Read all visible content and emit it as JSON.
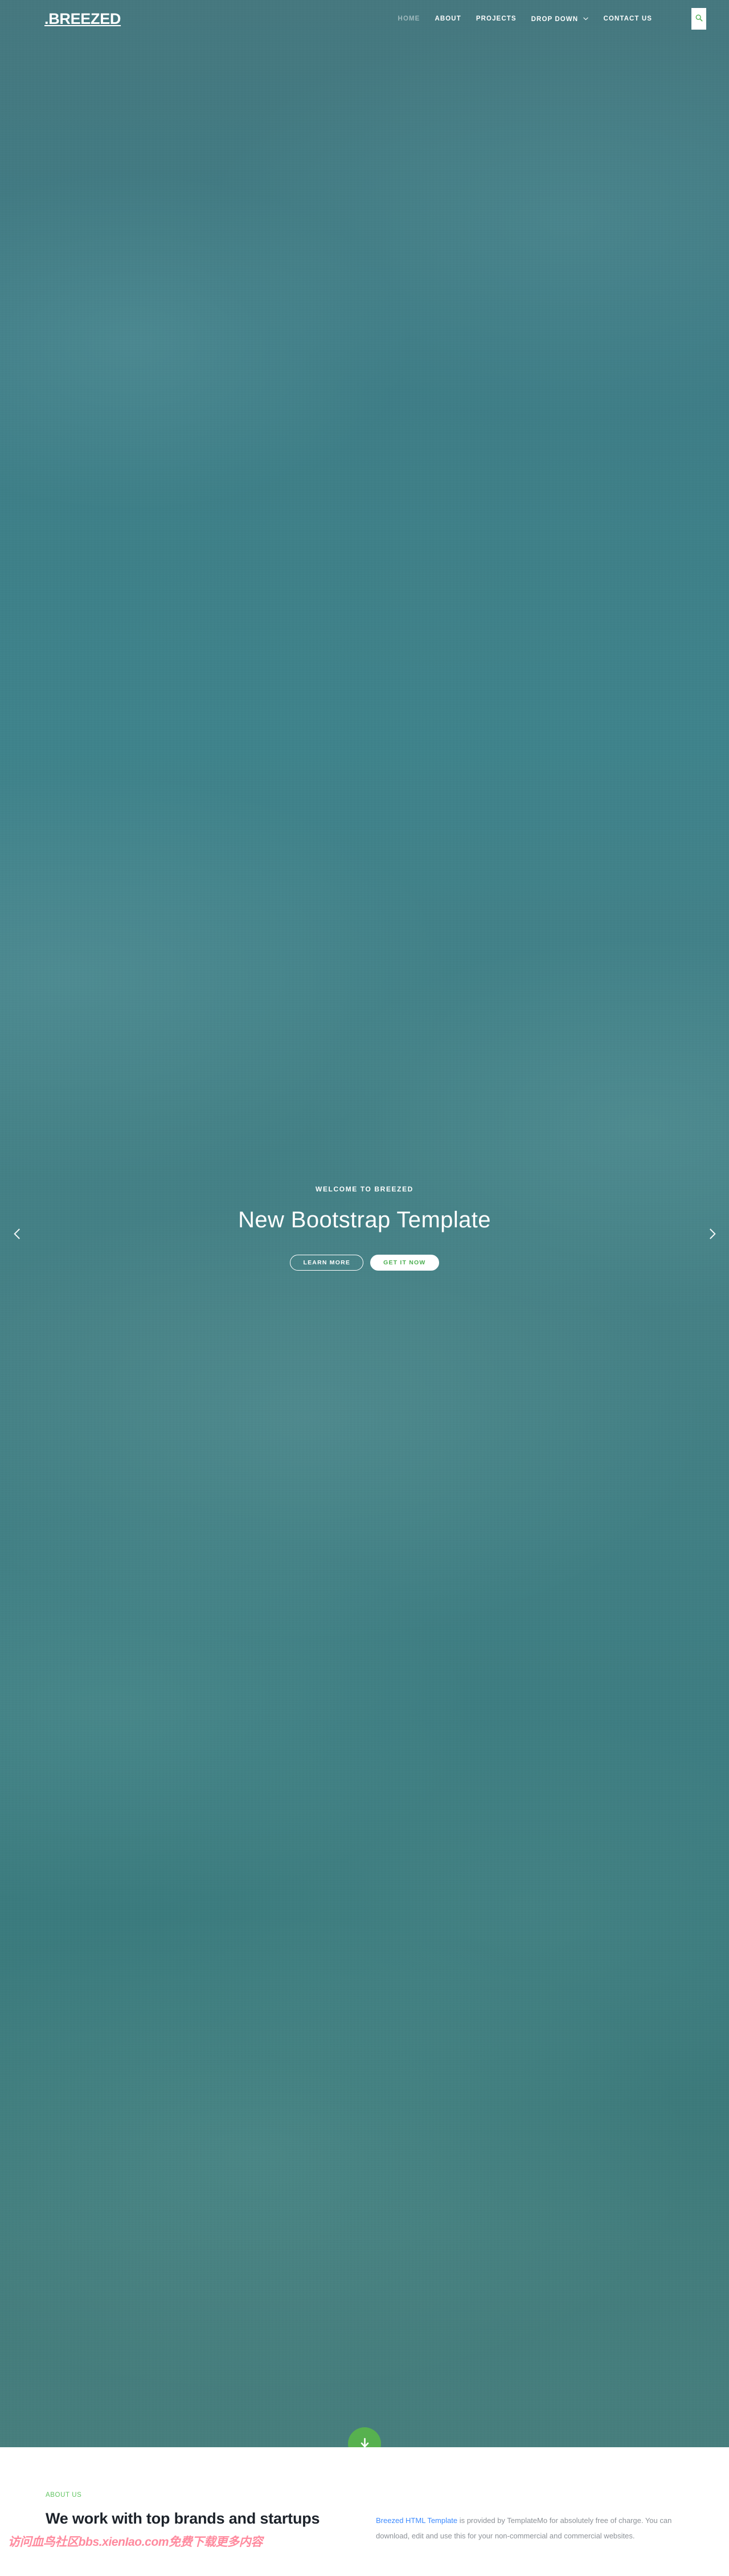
{
  "header": {
    "logo": ".BREEZED",
    "nav": [
      {
        "label": "HOME",
        "active": true
      },
      {
        "label": "ABOUT",
        "active": false
      },
      {
        "label": "PROJECTS",
        "active": false
      },
      {
        "label": "DROP DOWN",
        "active": false,
        "caret": "⌄"
      },
      {
        "label": "CONTACT US",
        "active": false
      }
    ],
    "search_icon": "search-icon"
  },
  "hero": {
    "subtitle": "WELCOME TO BREEZED",
    "title": "New Bootstrap Template",
    "buttons": {
      "learn_more": "LEARN MORE",
      "get_it_now": "GET IT NOW"
    },
    "prev_label": "‹",
    "next_label": "›",
    "scroll_down_icon": "arrow-down-icon"
  },
  "about": {
    "label": "ABOUT US",
    "title": "We work with top brands and startups",
    "paragraph_link": "Breezed HTML Template",
    "paragraph_rest": " is provided by TemplateMo for absolutely free of charge. You can download, edit and use this for your non-commercial and commercial websites."
  },
  "watermark": {
    "text": "访问血鸟社区bbs.xienIao.com免费下载更多内容"
  },
  "colors": {
    "teal_bg": "#3f7a82",
    "accent_green": "#57b14f",
    "label_green": "#5fc45f",
    "link_blue": "#3d8bff",
    "heading_dark": "#1d232b",
    "body_gray": "#8d9298",
    "watermark_pink": "#ff8a9e"
  }
}
